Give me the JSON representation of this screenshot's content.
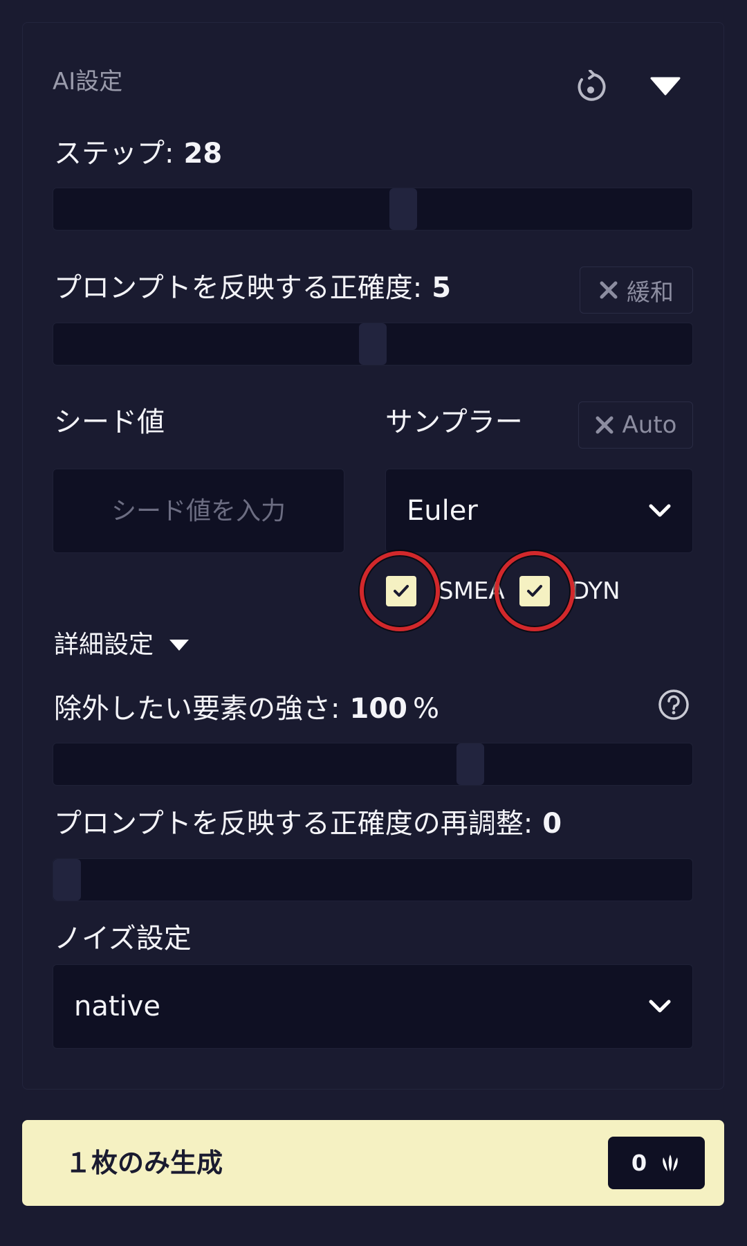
{
  "panel": {
    "title": "AI設定"
  },
  "steps": {
    "label": "ステップ:",
    "value": "28",
    "slider_fraction": 0.55
  },
  "cfg": {
    "label": "プロンプトを反映する正確度:",
    "value": "5",
    "slider_fraction": 0.5,
    "chip_label": "緩和"
  },
  "seed": {
    "label": "シード値",
    "placeholder": "シード値を入力"
  },
  "sampler": {
    "label": "サンプラー",
    "chip_label": "Auto",
    "selected": "Euler",
    "smea_label": "SMEA",
    "dyn_label": "DYN",
    "smea_checked": true,
    "dyn_checked": true
  },
  "advanced": {
    "toggle_label": "詳細設定"
  },
  "negative_strength": {
    "label": "除外したい要素の強さ:",
    "value": "100",
    "unit": "%",
    "slider_fraction": 0.66
  },
  "cfg_rescale": {
    "label": "プロンプトを反映する正確度の再調整:",
    "value": "0",
    "slider_fraction": 0
  },
  "noise": {
    "label": "ノイズ設定",
    "selected": "native"
  },
  "generate": {
    "label": "１枚のみ生成",
    "cost": "0"
  },
  "colors": {
    "background": "#1a1b30",
    "field": "#0f1023",
    "accent": "#f5f1c2",
    "annotation_ring": "#d2282b"
  }
}
